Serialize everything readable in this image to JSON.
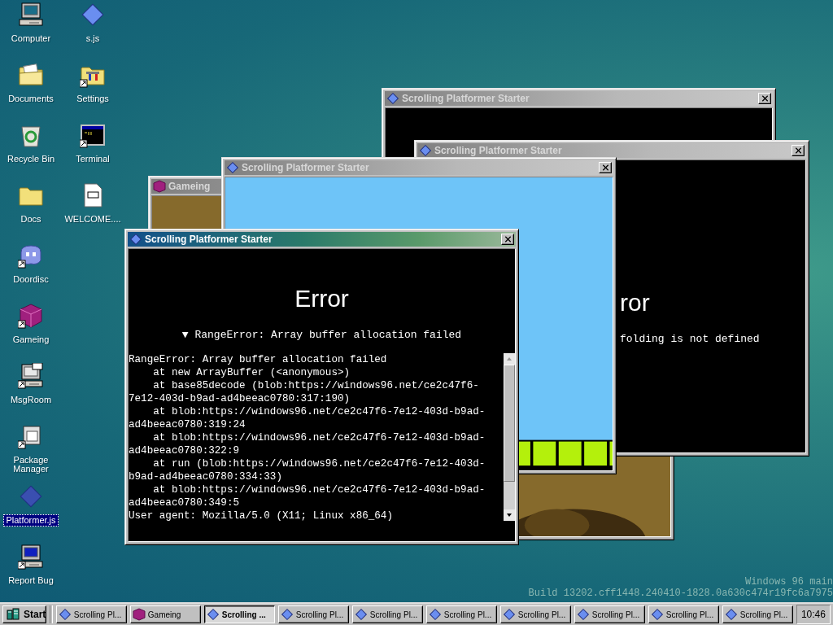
{
  "desktop_icons": [
    {
      "label": "Computer",
      "kind": "computer",
      "shortcut": false,
      "selected": false
    },
    {
      "label": "Documents",
      "kind": "documents",
      "shortcut": false,
      "selected": false
    },
    {
      "label": "Recycle Bin",
      "kind": "recycle",
      "shortcut": false,
      "selected": false
    },
    {
      "label": "Docs",
      "kind": "folder",
      "shortcut": false,
      "selected": false
    },
    {
      "label": "Doordisc",
      "kind": "chat",
      "shortcut": true,
      "selected": false
    },
    {
      "label": "Gameing",
      "kind": "cube",
      "shortcut": true,
      "selected": false
    },
    {
      "label": "MsgRoom",
      "kind": "msg",
      "shortcut": true,
      "selected": false
    },
    {
      "label": "Package Manager",
      "kind": "package",
      "shortcut": true,
      "selected": false
    },
    {
      "label": "Platformer.js",
      "kind": "diamond",
      "shortcut": false,
      "selected": true
    },
    {
      "label": "Report Bug",
      "kind": "report",
      "shortcut": true,
      "selected": false
    },
    {
      "label": "s.js",
      "kind": "diamond",
      "shortcut": false,
      "selected": false
    },
    {
      "label": "Settings",
      "kind": "settings",
      "shortcut": true,
      "selected": false
    },
    {
      "label": "Terminal",
      "kind": "terminal",
      "shortcut": true,
      "selected": false
    },
    {
      "label": "WELCOME....",
      "kind": "markdown",
      "shortcut": false,
      "selected": false
    }
  ],
  "windows": [
    {
      "title": "Scrolling Platformer Starter",
      "kind": "diamond",
      "active": false,
      "content": {
        "kind": "blank"
      }
    },
    {
      "title": "Gameing",
      "kind": "cube",
      "active": false,
      "content": {
        "kind": "ground"
      }
    },
    {
      "title": "Scrolling Platformer Starter",
      "kind": "diamond",
      "active": false,
      "content": {
        "kind": "error",
        "heading": "ror",
        "message": "folding is not defined"
      }
    },
    {
      "title": "Scrolling Platformer Starter",
      "kind": "diamond",
      "active": false,
      "content": {
        "kind": "platformer"
      }
    },
    {
      "title": "Scrolling Platformer Starter",
      "kind": "diamond",
      "active": true,
      "content": {
        "kind": "error-details",
        "heading": "Error",
        "summary": "▼ RangeError: Array buffer allocation failed",
        "stack_lines": [
          "RangeError: Array buffer allocation failed",
          "    at new ArrayBuffer (<anonymous>)",
          "    at base85decode (blob:https://windows96.net/ce2c47f6-",
          "7e12-403d-b9ad-ad4beeac0780:317:190)",
          "    at blob:https://windows96.net/ce2c47f6-7e12-403d-b9ad-",
          "ad4beeac0780:319:24",
          "    at blob:https://windows96.net/ce2c47f6-7e12-403d-b9ad-",
          "ad4beeac0780:322:9",
          "    at run (blob:https://windows96.net/ce2c47f6-7e12-403d-",
          "b9ad-ad4beeac0780:334:33)",
          "    at blob:https://windows96.net/ce2c47f6-7e12-403d-b9ad-",
          "ad4beeac0780:349:5",
          "User agent: Mozilla/5.0 (X11; Linux x86_64)"
        ]
      }
    }
  ],
  "watermark": [
    "Windows 96 main",
    "Build 13202.cff1448.240410-1828.0a630c474r19fc6a7975"
  ],
  "taskbar": {
    "start": "Start",
    "tasks": [
      {
        "label": "Scrolling Pl...",
        "kind": "diamond",
        "selected": false
      },
      {
        "label": "Gameing",
        "kind": "cube",
        "selected": false
      },
      {
        "label": "Scrolling ...",
        "kind": "diamond",
        "selected": true
      },
      {
        "label": "Scrolling Pl...",
        "kind": "diamond",
        "selected": false
      },
      {
        "label": "Scrolling Pl...",
        "kind": "diamond",
        "selected": false
      },
      {
        "label": "Scrolling Pl...",
        "kind": "diamond",
        "selected": false
      },
      {
        "label": "Scrolling Pl...",
        "kind": "diamond",
        "selected": false
      },
      {
        "label": "Scrolling Pl...",
        "kind": "diamond",
        "selected": false
      },
      {
        "label": "Scrolling Pl...",
        "kind": "diamond",
        "selected": false
      },
      {
        "label": "Scrolling Pl...",
        "kind": "diamond",
        "selected": false
      }
    ],
    "clock": "10:46"
  }
}
